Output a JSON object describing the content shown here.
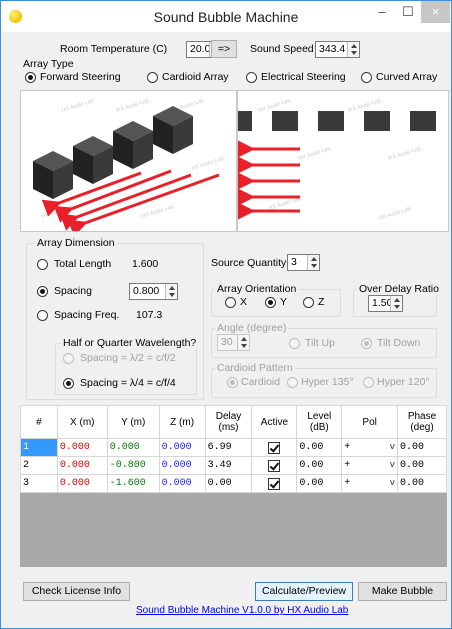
{
  "window": {
    "title": "Sound Bubble Machine",
    "minimize_glyph": "–",
    "maximize_glyph": "☐",
    "close_glyph": "×"
  },
  "env": {
    "room_temp_label": "Room Temperature (C)",
    "room_temp_value": "20.0",
    "convert_label": "=>",
    "sound_speed_label": "Sound Speed",
    "sound_speed_value": "343.4"
  },
  "array_type": {
    "group_label": "Array Type",
    "options": [
      "Forward Steering",
      "Cardioid Array",
      "Electrical Steering",
      "Curved Array"
    ],
    "selected": "Forward Steering"
  },
  "preview": {
    "watermark": "HX Audio Lab"
  },
  "array_dimension": {
    "group_label": "Array Dimension",
    "total_length_label": "Total Length",
    "total_length_value": "1.600",
    "spacing_label": "Spacing",
    "spacing_value": "0.800",
    "spacing_freq_label": "Spacing Freq.",
    "spacing_freq_value": "107.3",
    "selected": "Spacing",
    "wavelength_group_label": "Half or Quarter Wavelength?",
    "half_label": "Spacing = λ/2 = c/f/2",
    "quarter_label": "Spacing = λ/4 = c/f/4",
    "wavelength_selected": "quarter"
  },
  "source_quantity": {
    "label": "Source Quantity",
    "value": "3"
  },
  "orientation": {
    "group_label": "Array Orientation",
    "options": [
      "X",
      "Y",
      "Z"
    ],
    "selected": "Y"
  },
  "over_delay": {
    "group_label": "Over Delay Ratio",
    "value": "1.50"
  },
  "angle": {
    "group_label": "Angle (degree)",
    "value": "30",
    "tilt_up_label": "Tilt Up",
    "tilt_down_label": "Tilt Down",
    "selected": "Tilt Down"
  },
  "cardioid": {
    "group_label": "Cardioid Pattern",
    "options": [
      "Cardioid",
      "Hyper 135°",
      "Hyper 120°"
    ],
    "selected": "Cardioid"
  },
  "table": {
    "headers": [
      "#",
      "X (m)",
      "Y (m)",
      "Z (m)",
      "Delay (ms)",
      "Active",
      "Level (dB)",
      "Pol",
      "Phase (deg)"
    ],
    "rows": [
      {
        "n": "1",
        "x": "0.000",
        "y": "0.000",
        "z": "0.000",
        "delay": "6.99",
        "active": true,
        "level": "0.00",
        "pol": "+",
        "phase": "0.00"
      },
      {
        "n": "2",
        "x": "0.000",
        "y": "-0.800",
        "z": "0.000",
        "delay": "3.49",
        "active": true,
        "level": "0.00",
        "pol": "+",
        "phase": "0.00"
      },
      {
        "n": "3",
        "x": "0.000",
        "y": "-1.600",
        "z": "0.000",
        "delay": "0.00",
        "active": true,
        "level": "0.00",
        "pol": "+",
        "phase": "0.00"
      }
    ]
  },
  "footer": {
    "check_license_label": "Check License Info",
    "calculate_label": "Calculate/Preview",
    "make_bubble_label": "Make Bubble",
    "version_link": "Sound Bubble Machine V1.0.0 by HX Audio Lab"
  },
  "colors": {
    "x_column": "#d60000",
    "y_column": "#007a00",
    "z_column": "#1a1aff",
    "arrow": "#e8202a",
    "speaker": "#2b2b2b",
    "accent_border": "#3a8fd8"
  }
}
